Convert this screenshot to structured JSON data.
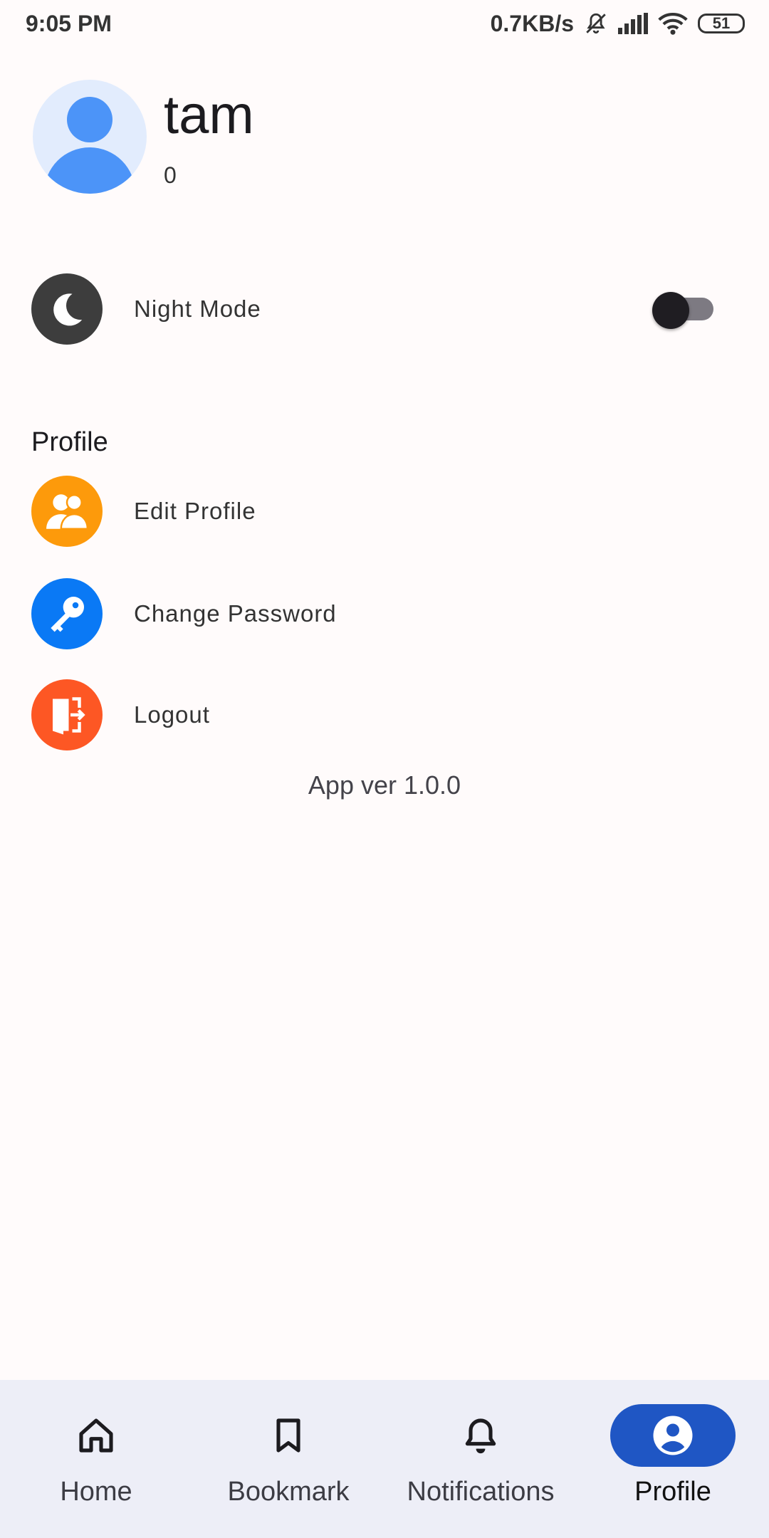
{
  "status_bar": {
    "time": "9:05 PM",
    "network_speed": "0.7KB/s",
    "battery": "51",
    "icons": [
      "mute-icon",
      "signal-icon",
      "wifi-icon",
      "battery-icon"
    ]
  },
  "profile": {
    "name": "tam",
    "count": "0"
  },
  "settings": {
    "night_mode_label": "Night Mode",
    "night_mode_on": false
  },
  "profile_section": {
    "title": "Profile",
    "items": [
      {
        "label": "Edit Profile",
        "icon": "users-icon",
        "color": "#fd9a0b"
      },
      {
        "label": "Change Password",
        "icon": "key-icon",
        "color": "#0a79f5"
      },
      {
        "label": "Logout",
        "icon": "logout-icon",
        "color": "#fd5724"
      }
    ]
  },
  "app_version": "App ver 1.0.0",
  "bottom_nav": {
    "items": [
      {
        "label": "Home",
        "icon": "home-icon"
      },
      {
        "label": "Bookmark",
        "icon": "bookmark-icon"
      },
      {
        "label": "Notifications",
        "icon": "bell-icon"
      },
      {
        "label": "Profile",
        "icon": "profile-icon",
        "active": true
      }
    ],
    "active_color": "#1f56c4"
  },
  "colors": {
    "background": "#fffbfb",
    "night_mode_icon": "#3d3d3d",
    "avatar_bg": "#e2ecfd",
    "avatar_fg": "#4c94f8"
  }
}
